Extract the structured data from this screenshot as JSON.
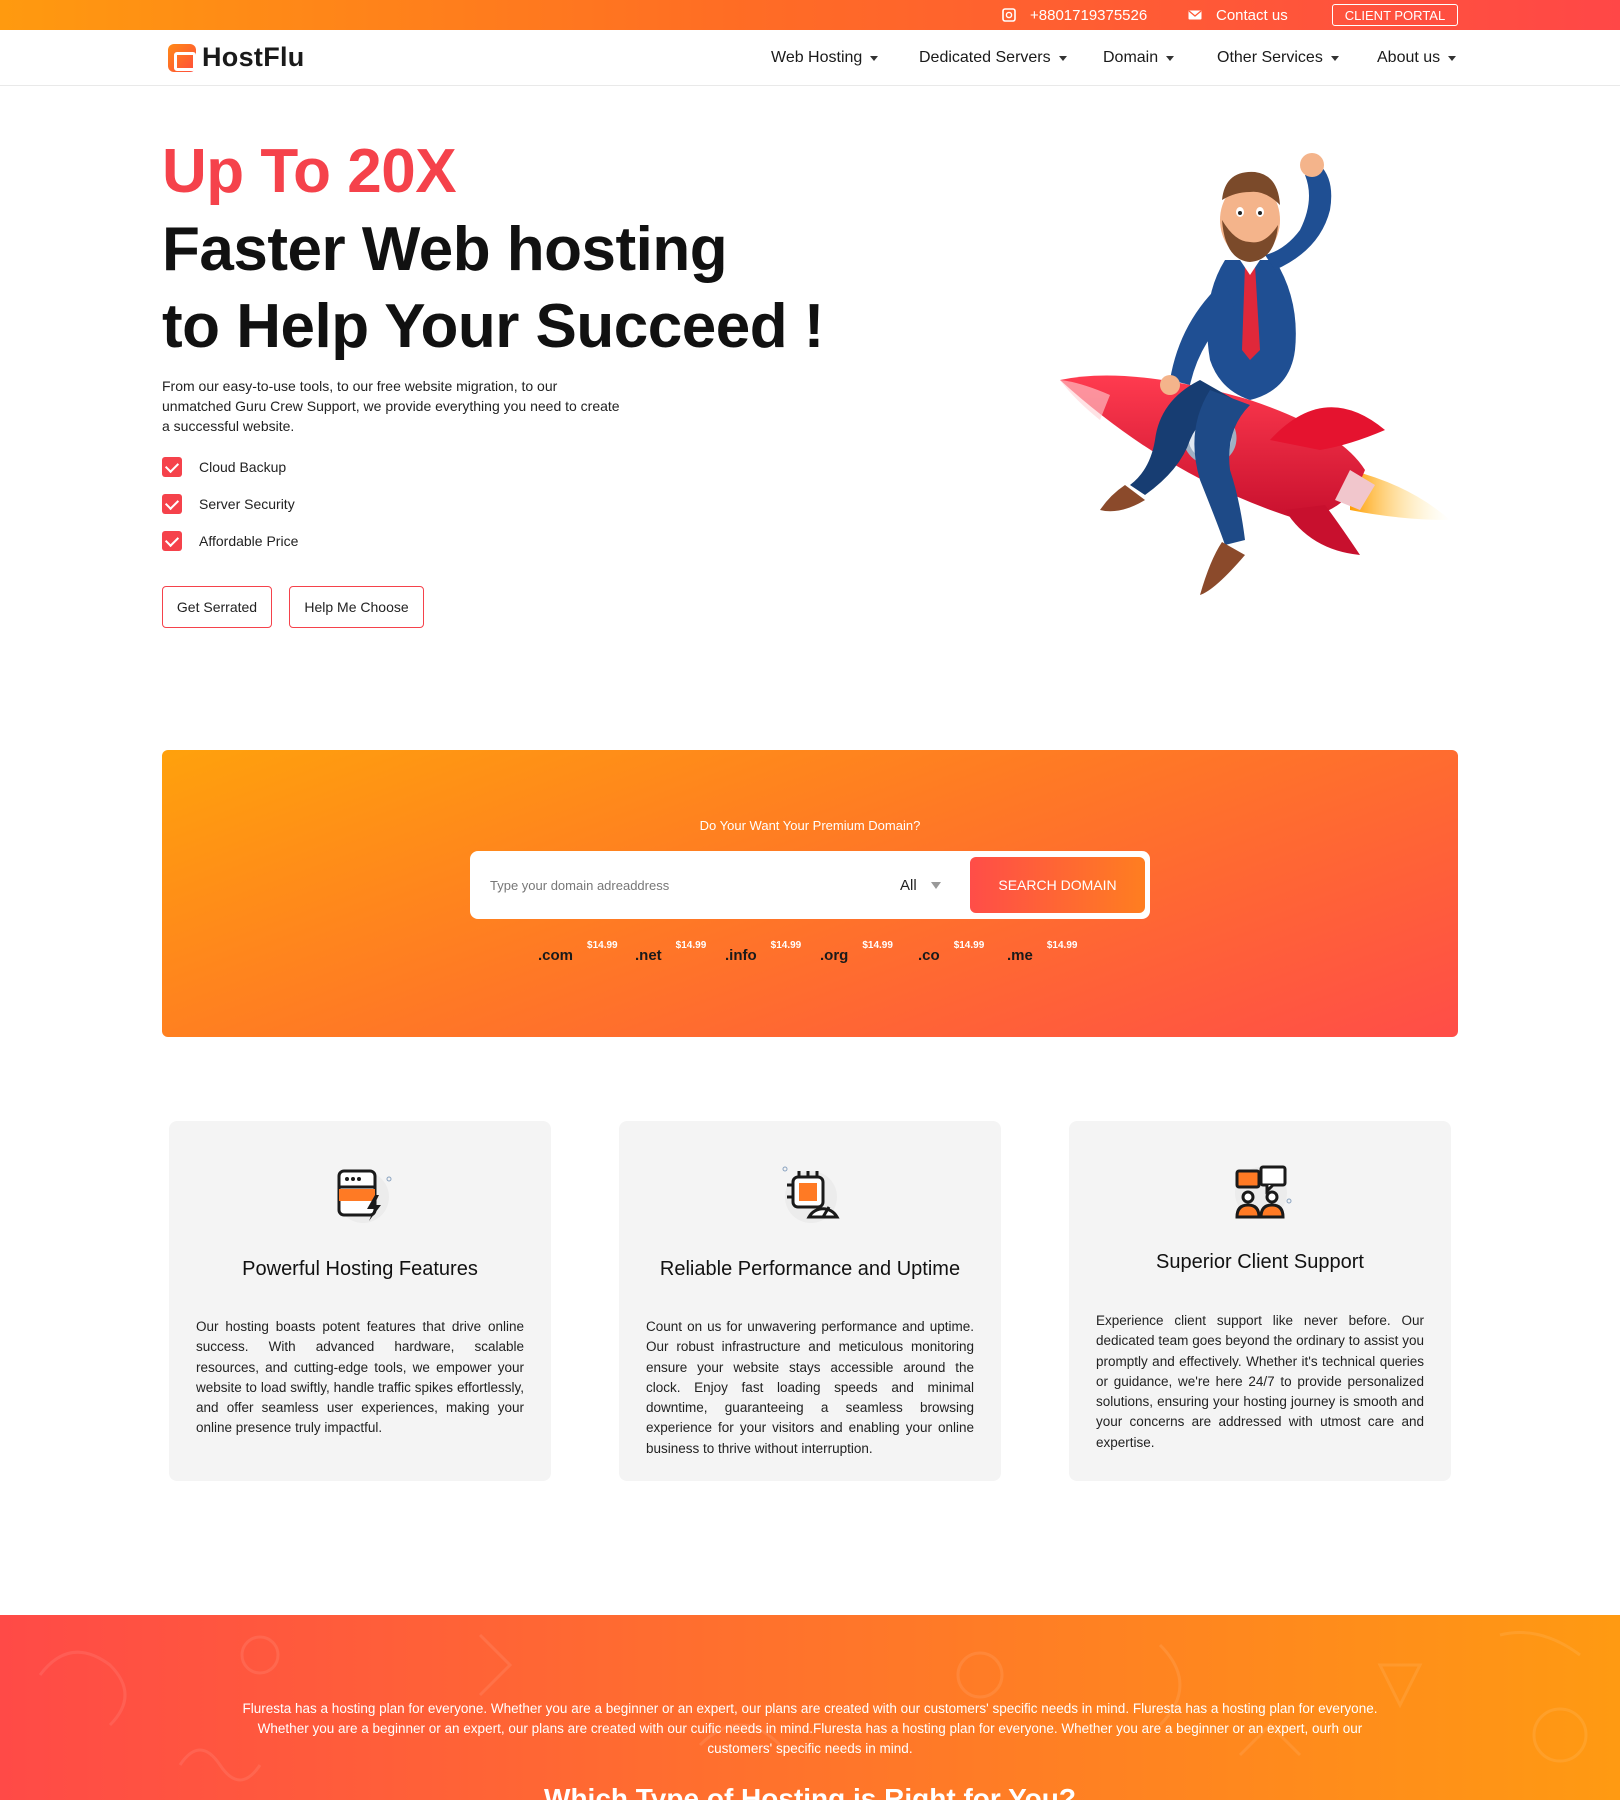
{
  "topbar": {
    "phone": "+8801719375526",
    "contact": "Contact us",
    "portal": "CLIENT PORTAL"
  },
  "header": {
    "logo": "HostFlu",
    "nav": [
      "Web Hosting",
      "Dedicated Servers",
      "Domain",
      "Other Services",
      "About us"
    ]
  },
  "hero": {
    "highlight": "Up To 20X",
    "line1": "Faster Web hosting",
    "line2": "to Help Your Succeed !",
    "description": "From our easy-to-use tools, to our free website migration, to our unmatched Guru Crew Support, we provide everything you need to create a successful website.",
    "features": [
      "Cloud Backup",
      "Server Security",
      "Affordable Price"
    ],
    "buttons": [
      "Get Serrated",
      "Help Me Choose"
    ]
  },
  "domain": {
    "title": "Do Your Want Your Premium Domain?",
    "placeholder": "Type your domain adreaddress",
    "select": "All",
    "button": "SEARCH DOMAIN",
    "tlds": [
      {
        "ext": ".com",
        "price": "$14.99"
      },
      {
        "ext": ".net",
        "price": "$14.99"
      },
      {
        "ext": ".info",
        "price": "$14.99"
      },
      {
        "ext": ".org",
        "price": "$14.99"
      },
      {
        "ext": ".co",
        "price": "$14.99"
      },
      {
        "ext": ".me",
        "price": "$14.99"
      }
    ]
  },
  "features": [
    {
      "icon": "server-bolt-icon",
      "title": "Powerful Hosting Features",
      "text": "Our hosting boasts potent features that drive online success. With advanced hardware, scalable resources, and cutting-edge tools, we empower your website to load swiftly, handle traffic spikes effortlessly, and offer seamless user experiences, making your online presence truly impactful."
    },
    {
      "icon": "chip-gauge-icon",
      "title": "Reliable Performance and Uptime",
      "text": "Count on us for unwavering performance and uptime. Our robust infrastructure and meticulous monitoring ensure your website stays accessible around the clock. Enjoy fast loading speeds and minimal downtime, guaranteeing a seamless browsing experience for your visitors and enabling your online business to thrive without interruption."
    },
    {
      "icon": "support-chat-icon",
      "title": "Superior Client Support",
      "text": "Experience client support like never before. Our dedicated team goes beyond the ordinary to assist you promptly and effectively. Whether it's technical queries or guidance, we're here 24/7 to provide personalized solutions, ensuring your hosting journey is smooth and your concerns are addressed with utmost care and expertise."
    }
  ],
  "plans": {
    "intro": "Fluresta has a hosting plan for everyone. Whether you are a beginner or an expert, our plans are created with our customers' specific needs in mind. Fluresta has a hosting plan for everyone. Whether you are a beginner or an expert, our plans are created with our cuific needs in mind.Fluresta has a hosting plan for everyone. Whether you are a beginner or an expert, ourh our customers' specific needs in mind.",
    "heading": "Which Type of Hosting is Right for You?"
  },
  "colors": {
    "accent": "#f5424b",
    "orange": "#ff9a0f",
    "card_bg": "#f4f4f4"
  }
}
